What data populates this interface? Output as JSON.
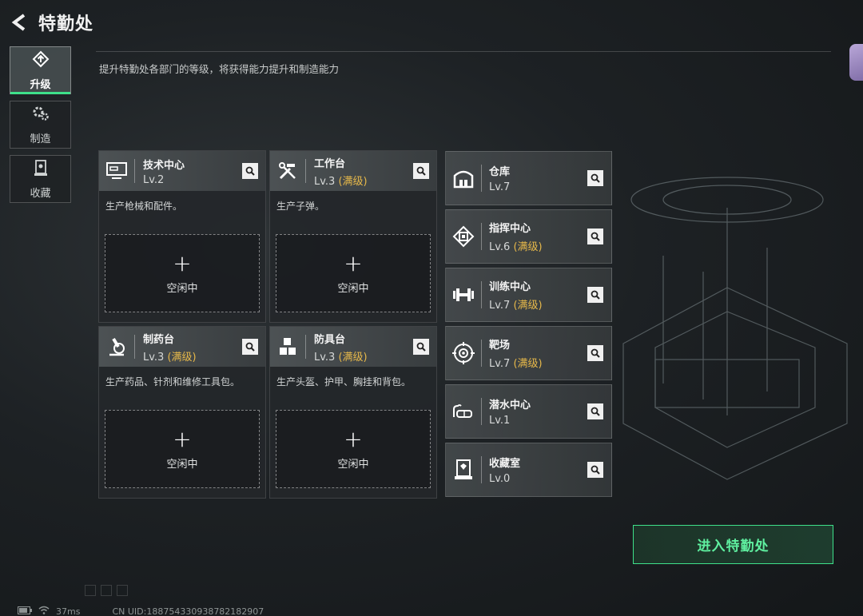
{
  "header": {
    "title": "特勤处"
  },
  "description": "提升特勤处各部门的等级，将获得能力提升和制造能力",
  "sidebar": {
    "tabs": [
      {
        "label": "升级",
        "icon": "upgrade-icon",
        "active": true
      },
      {
        "label": "制造",
        "icon": "gears-icon",
        "active": false
      },
      {
        "label": "收藏",
        "icon": "display-case-icon",
        "active": false
      }
    ]
  },
  "workshops": [
    {
      "name": "技术中心",
      "level": "Lv.2",
      "max": "",
      "desc": "生产枪械和配件。",
      "icon": "computer-icon",
      "slot_plus": "+",
      "slot_label": "空闲中"
    },
    {
      "name": "工作台",
      "level": "Lv.3",
      "max": "(满级)",
      "desc": "生产子弹。",
      "icon": "tools-icon",
      "slot_plus": "+",
      "slot_label": "空闲中"
    },
    {
      "name": "制药台",
      "level": "Lv.3",
      "max": "(满级)",
      "desc": "生产药品、针剂和维修工具包。",
      "icon": "microscope-icon",
      "slot_plus": "+",
      "slot_label": "空闲中"
    },
    {
      "name": "防具台",
      "level": "Lv.3",
      "max": "(满级)",
      "desc": "生产头盔、护甲、胸挂和背包。",
      "icon": "cubes-icon",
      "slot_plus": "+",
      "slot_label": "空闲中"
    }
  ],
  "facilities": [
    {
      "name": "仓库",
      "level": "Lv.7",
      "max": "",
      "icon": "warehouse-icon"
    },
    {
      "name": "指挥中心",
      "level": "Lv.6",
      "max": "(满级)",
      "icon": "command-chip-icon"
    },
    {
      "name": "训练中心",
      "level": "Lv.7",
      "max": "(满级)",
      "icon": "dumbbell-icon"
    },
    {
      "name": "靶场",
      "level": "Lv.7",
      "max": "(满级)",
      "icon": "target-icon"
    },
    {
      "name": "潜水中心",
      "level": "Lv.1",
      "max": "",
      "icon": "diving-mask-icon"
    },
    {
      "name": "收藏室",
      "level": "Lv.0",
      "max": "",
      "icon": "collection-icon"
    }
  ],
  "enter_button": "进入特勤处",
  "footer": {
    "ping": "37ms",
    "uid": "CN UID:18875433093878218290​7"
  },
  "colors": {
    "accent_green": "#3ee08a",
    "max_level": "#e6b84a"
  }
}
